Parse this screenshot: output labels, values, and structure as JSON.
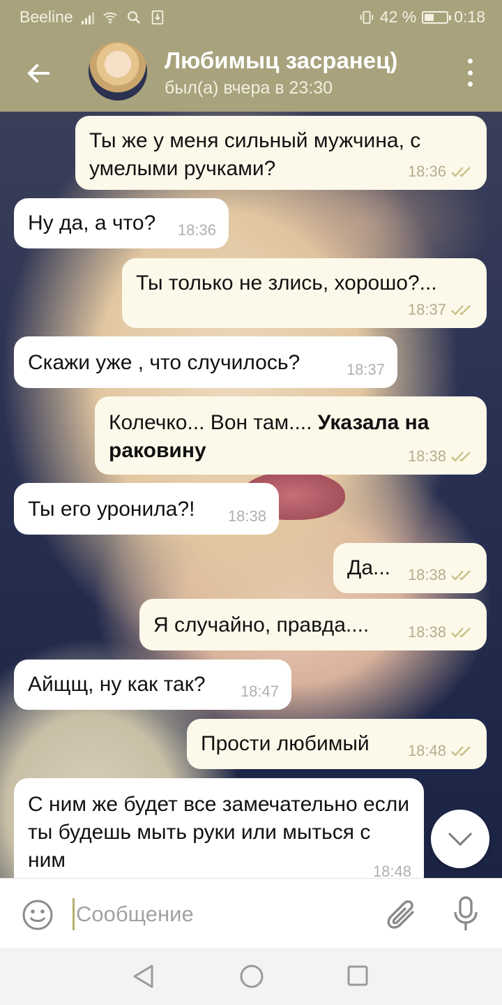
{
  "status_bar": {
    "carrier": "Beeline",
    "battery_text": "42 %",
    "battery_level": 0.42,
    "time": "0:18",
    "icons": [
      "signal-icon",
      "wifi-icon",
      "search-icon",
      "download-icon",
      "vibrate-icon",
      "battery-icon"
    ]
  },
  "header": {
    "contact_name": "Любимыц засранец)",
    "last_seen": "был(а) вчера в 23:30",
    "icons": [
      "back-arrow-icon",
      "avatar",
      "more-vert-icon"
    ]
  },
  "messages": [
    {
      "direction": "out",
      "text": "Ты же у меня сильный мужчина, с умелыми ручками?",
      "time": "18:36",
      "read": true
    },
    {
      "direction": "in",
      "text": "Ну да, а что?",
      "time": "18:36"
    },
    {
      "direction": "out",
      "text": "Ты только не злись, хорошо?...",
      "time": "18:37",
      "read": true
    },
    {
      "direction": "in",
      "text": "Скажи уже , что случилось?",
      "time": "18:37"
    },
    {
      "direction": "out",
      "text": "Колечко... Вон там.... ",
      "text_bold": "Указала на раковину",
      "time": "18:38",
      "read": true
    },
    {
      "direction": "in",
      "text": "Ты его уронила?!",
      "time": "18:38"
    },
    {
      "direction": "out",
      "text": "Да...",
      "time": "18:38",
      "read": true
    },
    {
      "direction": "out",
      "text": "Я случайно, правда....",
      "time": "18:38",
      "read": true
    },
    {
      "direction": "in",
      "text": "Айщщ, ну как так?",
      "time": "18:47"
    },
    {
      "direction": "out",
      "text": "Прости любимый",
      "time": "18:48",
      "read": true
    },
    {
      "direction": "in",
      "text": "С ним же будет все замечательно если ты будешь мыть руки или мыться с ним",
      "time": "18:48"
    }
  ],
  "input": {
    "placeholder": "Сообщение",
    "value": ""
  },
  "colors": {
    "header_bg": "#a8a27d",
    "outgoing_bubble": "#fdf9ea",
    "incoming_bubble": "#ffffff",
    "read_ticks": "#c9bf85"
  }
}
